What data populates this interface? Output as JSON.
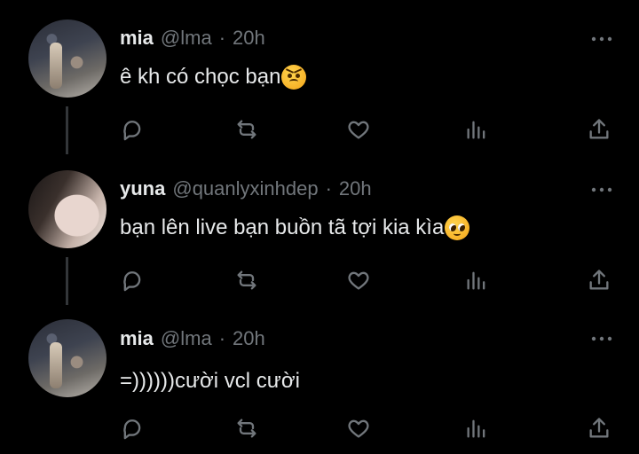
{
  "tweets": [
    {
      "name": "mia",
      "handle": "@lma",
      "separator": "·",
      "time": "20h",
      "text": "ê kh có chọc bạn",
      "emoji": "angry-face-icon"
    },
    {
      "name": "yuna",
      "handle": "@quanlyxinhdep",
      "separator": "·",
      "time": "20h",
      "text": "bạn lên live bạn buồn tã tợi kia kìa",
      "emoji": "pleading-face-icon"
    },
    {
      "name": "mia",
      "handle": "@lma",
      "separator": "·",
      "time": "20h",
      "text": "=))))))cười vcl cười",
      "emoji": ""
    }
  ],
  "icons": {
    "more": "more-horizontal-icon",
    "reply": "reply-icon",
    "retweet": "retweet-icon",
    "like": "heart-icon",
    "views": "views-icon",
    "share": "share-icon"
  },
  "colors": {
    "background": "#000000",
    "text": "#e7e9ea",
    "muted": "#71767b",
    "thread_line": "#333639"
  }
}
